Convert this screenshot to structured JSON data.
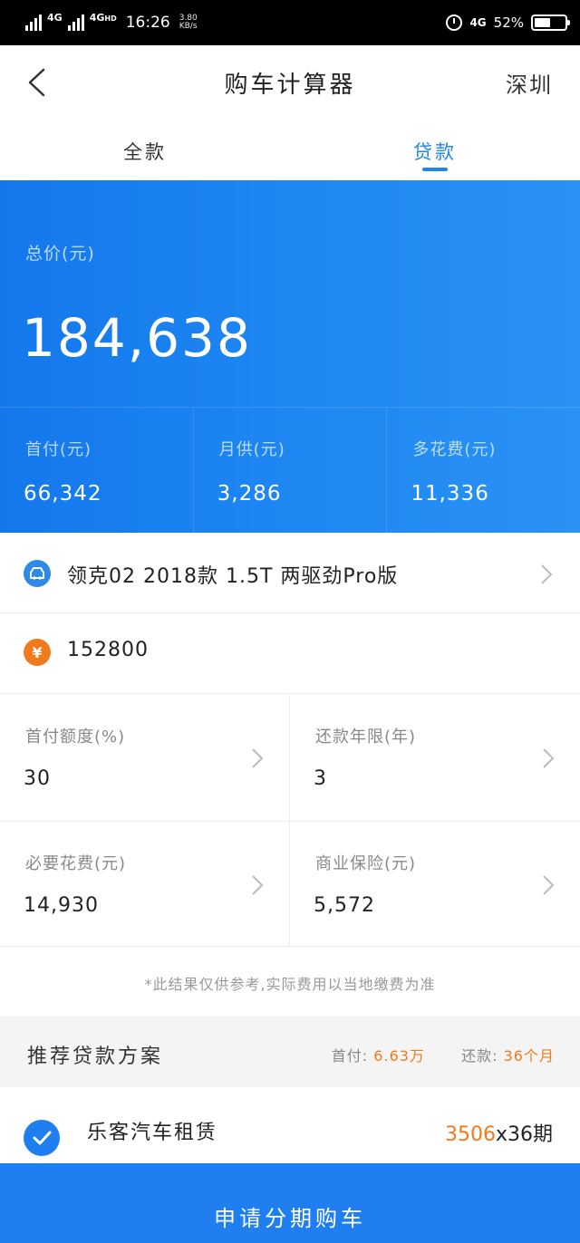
{
  "status_bar": {
    "network_1": "4G",
    "network_2": "4G",
    "network_2_suffix": "HD",
    "time": "16:26",
    "speed_value": "3.80",
    "speed_unit": "KB/s",
    "network_3": "4G",
    "battery": "52%",
    "battery_level": 0.52
  },
  "header": {
    "title": "购车计算器",
    "city": "深圳"
  },
  "tabs": [
    {
      "label": "全款",
      "active": false
    },
    {
      "label": "贷款",
      "active": true
    }
  ],
  "summary": {
    "total_label": "总价(元)",
    "total_value": "184,638",
    "metrics": [
      {
        "label": "首付(元)",
        "value": "66,342"
      },
      {
        "label": "月供(元)",
        "value": "3,286"
      },
      {
        "label": "多花费(元)",
        "value": "11,336"
      }
    ]
  },
  "car": {
    "model": "领克02 2018款 1.5T 两驱劲Pro版"
  },
  "price": {
    "icon_glyph": "¥",
    "value": "152800"
  },
  "options": [
    {
      "label": "首付额度(%)",
      "value": "30"
    },
    {
      "label": "还款年限(年)",
      "value": "3"
    },
    {
      "label": "必要花费(元)",
      "value": "14,930"
    },
    {
      "label": "商业保险(元)",
      "value": "5,572"
    }
  ],
  "disclaimer": "*此结果仅供参考,实际费用以当地缴费为准",
  "plan_section": {
    "title": "推荐贷款方案",
    "down_label": "首付:",
    "down_value": "6.63万",
    "term_label": "还款:",
    "term_value": "36个月"
  },
  "plan_item": {
    "name": "乐客汽车租赁",
    "amount_value": "3506",
    "amount_suffix": "x36期"
  },
  "apply_button": "申请分期购车",
  "colors": {
    "accent_blue": "#1f7ff0",
    "highlight_orange": "#f07a1c"
  }
}
